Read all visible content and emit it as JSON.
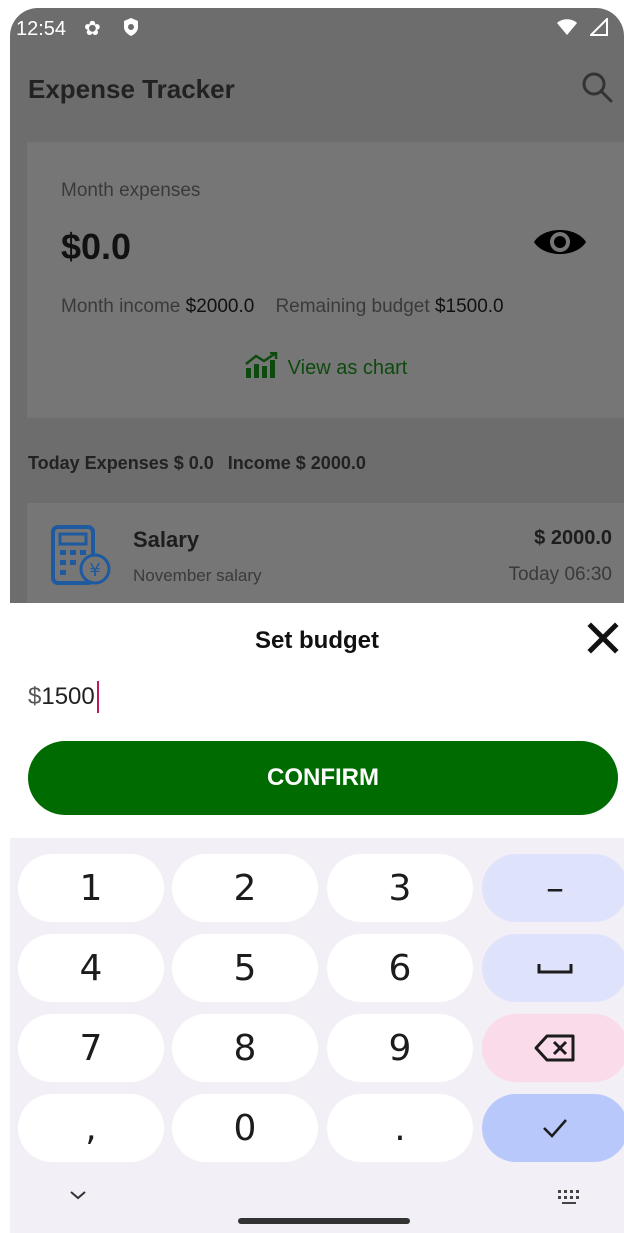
{
  "status_bar": {
    "time": "12:54"
  },
  "app": {
    "title": "Expense Tracker",
    "card": {
      "month_label": "Month expenses",
      "month_value": "$0.0",
      "income_label": "Month income",
      "income_value": "$2000.0",
      "remaining_label": "Remaining budget",
      "remaining_value": "$1500.0",
      "view_chart": "View as chart"
    },
    "today": {
      "expenses": "Today Expenses $ 0.0",
      "income": "Income $ 2000.0"
    },
    "transactions": [
      {
        "name": "Salary",
        "description": "November salary",
        "amount": "$ 2000.0",
        "date": "Today 06:30"
      }
    ]
  },
  "sheet": {
    "title": "Set budget",
    "input_prefix": "$",
    "input_value": "1500",
    "confirm": "CONFIRM"
  },
  "keyboard": {
    "keys": [
      "1",
      "2",
      "3",
      "–",
      "4",
      "5",
      "6",
      "␣",
      "7",
      "8",
      "9",
      "⌫",
      ",",
      "0",
      ".",
      "✓"
    ]
  },
  "colors": {
    "primary_green": "#006b00",
    "cursor": "#c2185b",
    "keyboard_bg": "#f2eff6"
  }
}
